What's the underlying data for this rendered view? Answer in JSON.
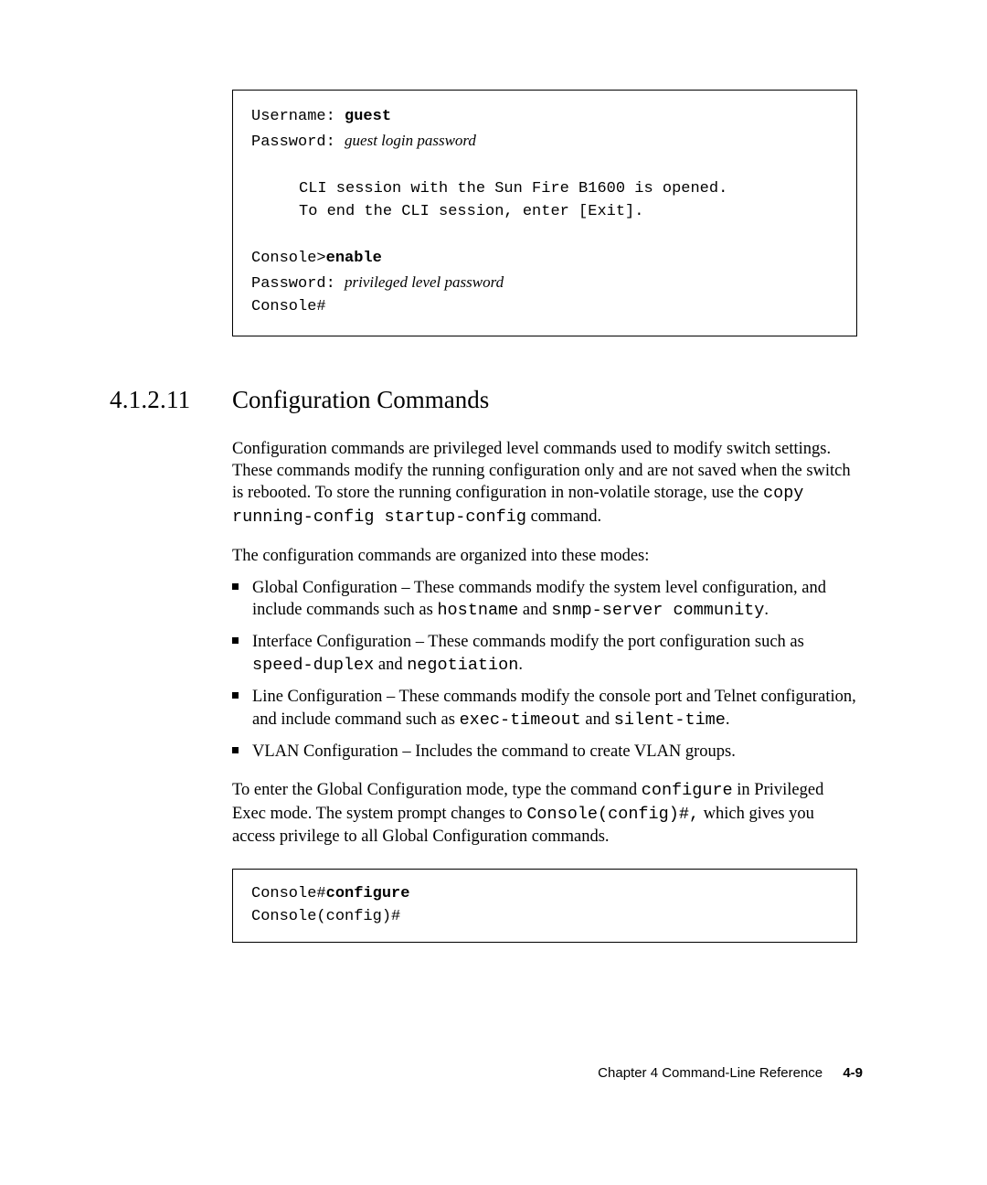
{
  "codebox1": {
    "l1a": "Username: ",
    "l1b": "guest",
    "l2a": "Password: ",
    "l2b": "guest login password",
    "l3": "CLI session with the Sun Fire B1600 is opened.",
    "l4": "To end the CLI session, enter [Exit].",
    "l5a": "Console>",
    "l5b": "enable",
    "l6a": "Password: ",
    "l6b": "privileged level password",
    "l7": "Console#"
  },
  "section": {
    "number": "4.1.2.11",
    "title": "Configuration Commands"
  },
  "para1": {
    "t1": "Configuration commands are privileged level commands used to modify switch settings. These commands modify the running configuration only and are not saved when the switch is rebooted. To store the running configuration in non-volatile storage, use the ",
    "cmd": "copy running-config startup-config",
    "t2": " command."
  },
  "para2": "The configuration commands are organized into these modes:",
  "bullets": {
    "b1": {
      "t1": "Global Configuration – These commands modify the system level configuration, and include commands such as ",
      "c1": "hostname",
      "t2": " and ",
      "c2": "snmp-server community",
      "t3": "."
    },
    "b2": {
      "t1": "Interface Configuration – These commands modify the port configuration such as ",
      "c1": "speed-duplex",
      "t2": " and ",
      "c2": "negotiation",
      "t3": "."
    },
    "b3": {
      "t1": "Line Configuration – These commands modify the console port and Telnet configuration, and include command such as ",
      "c1": "exec-timeout",
      "t2": " and ",
      "c2": "silent-time",
      "t3": "."
    },
    "b4": {
      "t1": "VLAN Configuration – Includes the command to create VLAN groups."
    }
  },
  "para3": {
    "t1": "To enter the Global Configuration mode, type the command ",
    "c1": "configure",
    "t2": " in Privileged Exec mode. The system prompt changes to ",
    "c2": "Console(config)#,",
    "t3": " which gives you access privilege to all Global Configuration commands."
  },
  "codebox2": {
    "l1a": "Console#",
    "l1b": "configure",
    "l2": "Console(config)#"
  },
  "footer": {
    "chapter": "Chapter 4    Command-Line Reference",
    "page": "4-9"
  }
}
